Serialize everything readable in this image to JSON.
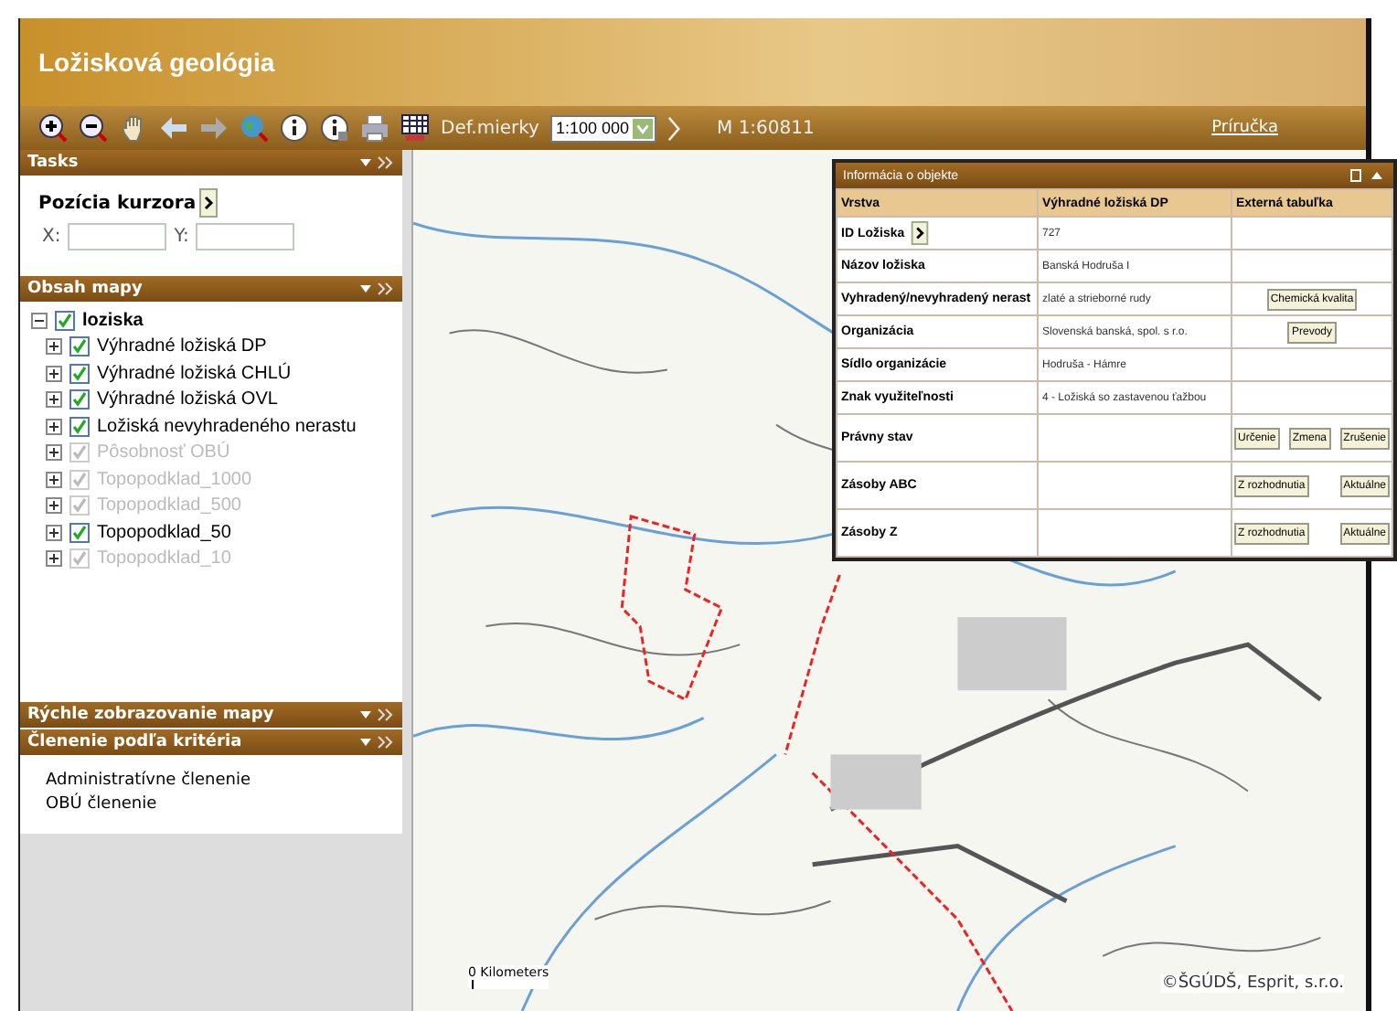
{
  "header": {
    "title": "Ložisková geológia"
  },
  "toolbar": {
    "scale_label": "Def.mierky",
    "scale_value": "1:100 000",
    "current_scale": "M 1:60811",
    "help_link": "Príručka"
  },
  "tasks": {
    "title": "Tasks",
    "cursor_label": "Pozícia kurzora",
    "x_label": "X:",
    "y_label": "Y:"
  },
  "map_contents": {
    "title": "Obsah mapy",
    "root": {
      "label": "loziska",
      "checked": true,
      "expanded": true,
      "children": [
        {
          "label": "Výhradné ložiská DP",
          "checked": true,
          "disabled": false
        },
        {
          "label": "Výhradné ložiská CHLÚ",
          "checked": true,
          "disabled": false
        },
        {
          "label": "Výhradné ložiská OVL",
          "checked": true,
          "disabled": false
        },
        {
          "label": "Ložiská nevyhradeného nerastu",
          "checked": true,
          "disabled": false
        },
        {
          "label": "Pôsobnosť OBÚ",
          "checked": true,
          "disabled": true
        },
        {
          "label": "Topopodklad_1000",
          "checked": true,
          "disabled": true
        },
        {
          "label": "Topopodklad_500",
          "checked": true,
          "disabled": true
        },
        {
          "label": "Topopodklad_50",
          "checked": true,
          "disabled": false
        },
        {
          "label": "Topopodklad_10",
          "checked": true,
          "disabled": true
        }
      ]
    }
  },
  "quick_view": {
    "title": "Rýchle zobrazovanie mapy"
  },
  "criteria": {
    "title": "Členenie podľa kritéria",
    "items": [
      "Administratívne členenie",
      "OBÚ členenie"
    ]
  },
  "info_window": {
    "title": "Informácia o objekte",
    "columns": [
      "Vrstva",
      "Výhradné ložiská DP",
      "Externá tabuľka"
    ],
    "rows": [
      {
        "label": "ID Ložiska",
        "arrow": true,
        "value": "727",
        "buttons": []
      },
      {
        "label": "Názov ložiska",
        "arrow": false,
        "value": "Banská Hodruša I",
        "buttons": []
      },
      {
        "label": "Vyhradený/nevyhradený nerast",
        "arrow": false,
        "value": "zlaté a strieborné rudy",
        "buttons": [
          "Chemická kvalita"
        ]
      },
      {
        "label": "Organizácia",
        "arrow": false,
        "value": "Slovenská banská, spol. s r.o.",
        "buttons": [
          "Prevody"
        ]
      },
      {
        "label": "Sídlo organizácie",
        "arrow": false,
        "value": "Hodruša - Hámre",
        "buttons": []
      },
      {
        "label": "Znak využiteľnosti",
        "arrow": false,
        "value": "4 - Ložiská so zastavenou ťažbou",
        "buttons": []
      },
      {
        "label": "Právny stav",
        "arrow": false,
        "value": "",
        "buttons": [
          "Určenie",
          "Zmena",
          "Zrušenie"
        ]
      },
      {
        "label": "Zásoby ABC",
        "arrow": false,
        "value": "",
        "buttons": [
          "Z rozhodnutia",
          "Aktuálne"
        ]
      },
      {
        "label": "Zásoby Z",
        "arrow": false,
        "value": "",
        "buttons": [
          "Z rozhodnutia",
          "Aktuálne"
        ]
      }
    ]
  },
  "map": {
    "scale_label": "0 Kilometers",
    "copyright": "©ŠGÚDŠ, Esprit, s.r.o."
  }
}
